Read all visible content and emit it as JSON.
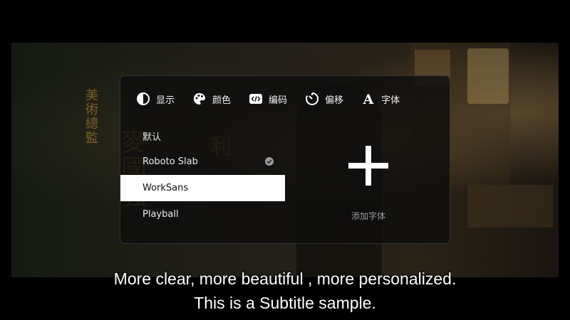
{
  "menu": {
    "tabs": [
      {
        "label": "显示",
        "icon": "contrast-icon"
      },
      {
        "label": "颜色",
        "icon": "palette-icon"
      },
      {
        "label": "编码",
        "icon": "code-icon"
      },
      {
        "label": "偏移",
        "icon": "timer-icon"
      },
      {
        "label": "字体",
        "icon": "font-a-icon"
      }
    ],
    "fonts": [
      {
        "label": "默认"
      },
      {
        "label": "Roboto Slab",
        "checked": true
      },
      {
        "label": "WorkSans",
        "selected": true
      },
      {
        "label": "Playball"
      }
    ],
    "add_font_label": "添加字体"
  },
  "subtitle": {
    "line1": "More clear, more beautiful , more personalized.",
    "line2": "This is a Subtitle sample."
  },
  "colors": {
    "panel_bg": "#0e0e0e",
    "selected_bg": "#ffffff",
    "text": "#f2f2f2",
    "muted": "#9a9a9a"
  }
}
